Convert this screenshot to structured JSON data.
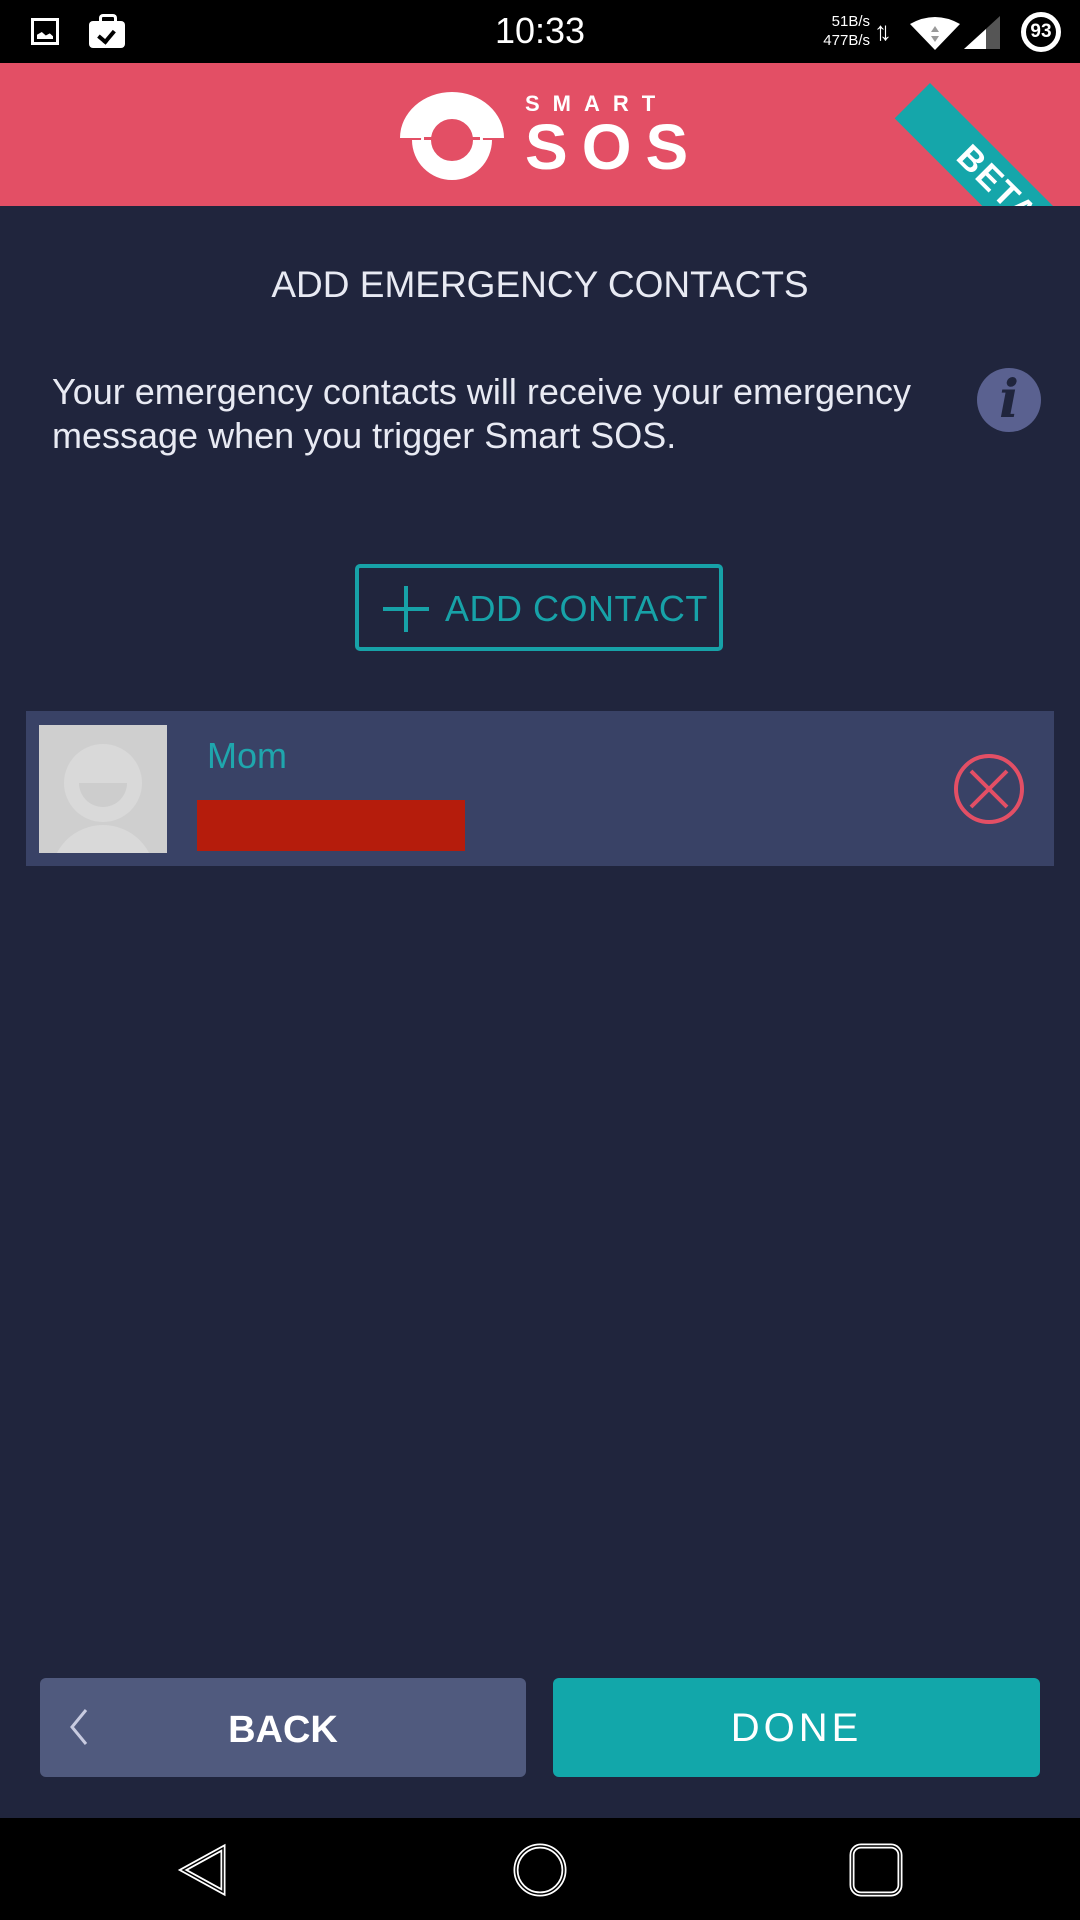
{
  "status_bar": {
    "time": "10:33",
    "upload_speed": "51B/s",
    "download_speed": "477B/s",
    "battery_level": "93",
    "icons": [
      "gallery-icon",
      "briefcase-check-icon",
      "data-arrows-icon",
      "wifi-icon",
      "cell-signal-icon",
      "battery-icon"
    ]
  },
  "header": {
    "logo_small": "SMART",
    "logo_large": "SOS",
    "ribbon": "BETA",
    "colors": {
      "header_bg": "#e34f65",
      "ribbon_bg": "#15a6aa"
    }
  },
  "main": {
    "title": "ADD EMERGENCY CONTACTS",
    "description": "Your emergency contacts will receive your emergency message when you trigger Smart SOS.",
    "info_icon": "info-icon",
    "add_contact_label": "ADD CONTACT",
    "contacts": [
      {
        "name": "Mom",
        "phone": "[redacted]",
        "avatar": "default-avatar"
      }
    ]
  },
  "footer": {
    "back_label": "BACK",
    "done_label": "DONE"
  },
  "nav_bar": {
    "icons": [
      "nav-back-icon",
      "nav-home-icon",
      "nav-recents-icon"
    ]
  },
  "colors": {
    "background": "#20253d",
    "accent": "#17a2a8",
    "danger": "#e34f65",
    "row_bg": "#394266",
    "back_button": "#505a7e",
    "done_button": "#12a7aa"
  }
}
